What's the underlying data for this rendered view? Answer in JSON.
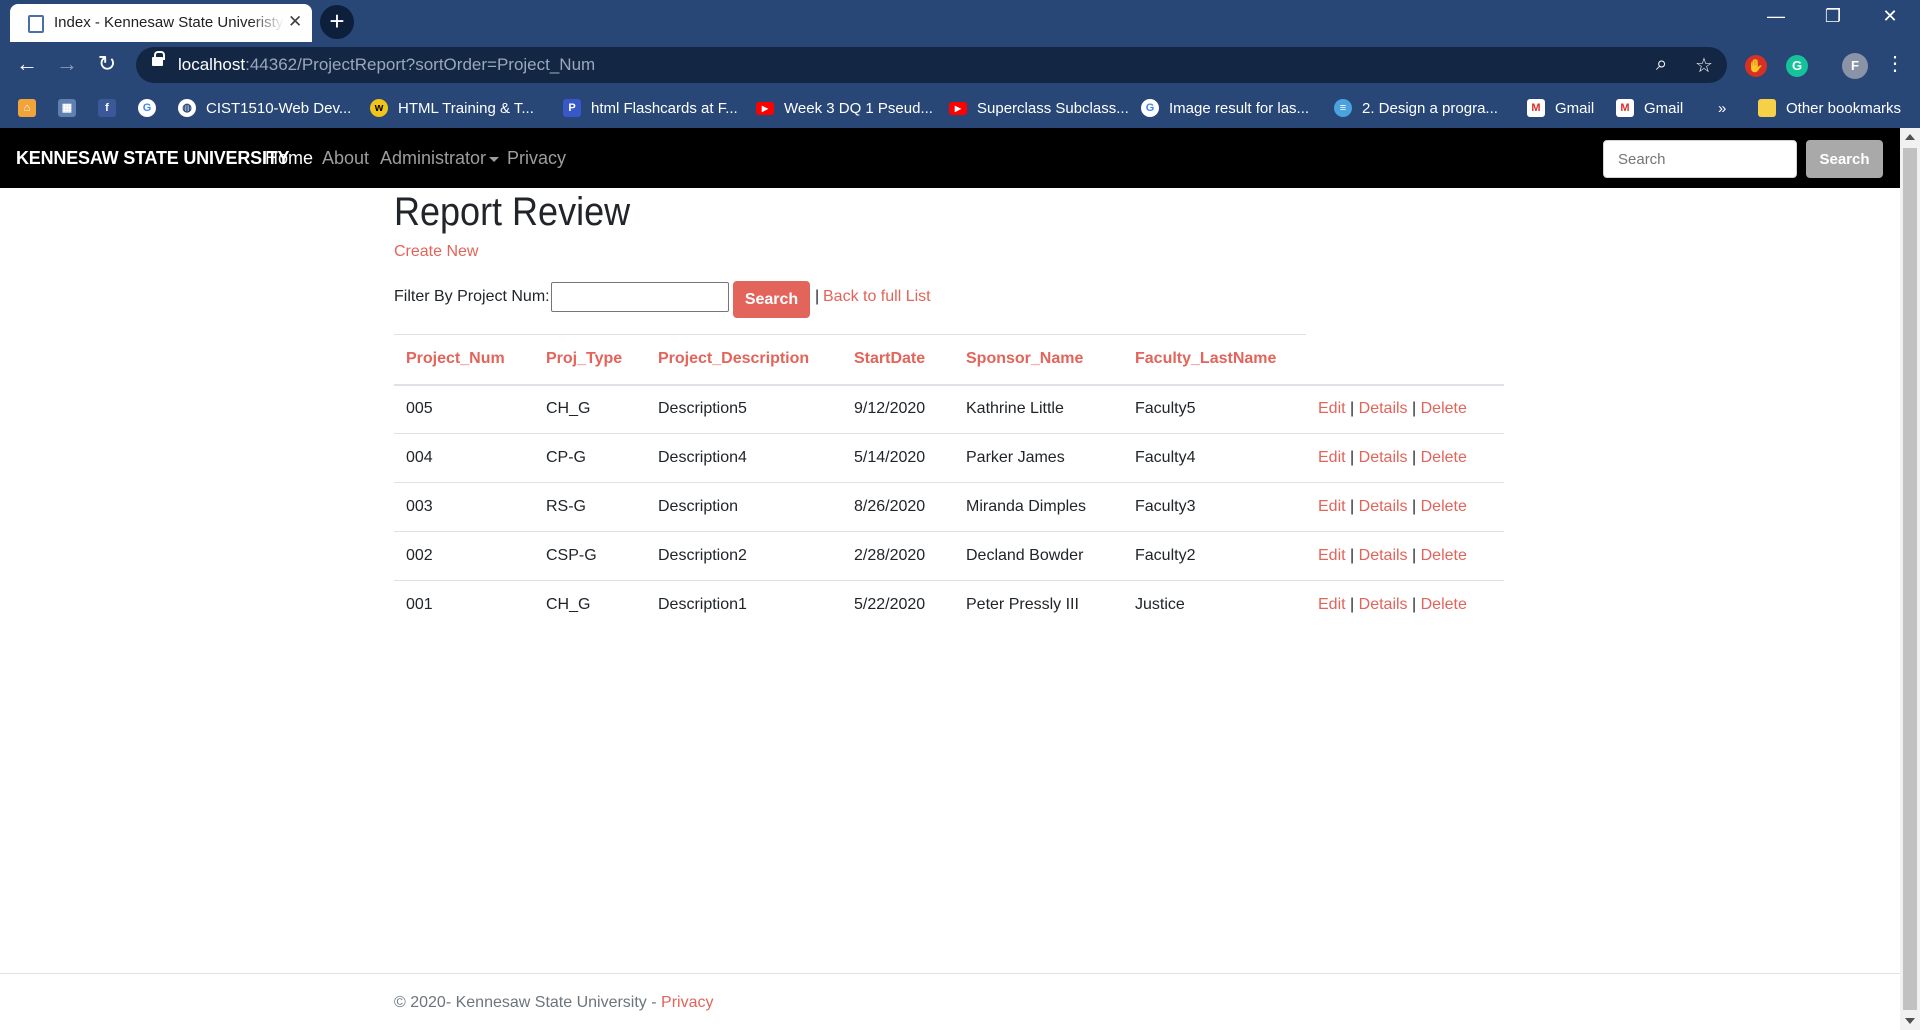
{
  "browser": {
    "tab_title": "Index - Kennesaw State Univeristy",
    "new_tab": "+",
    "url_host": "localhost",
    "url_rest": ":44362/ProjectReport?sortOrder=Project_Num",
    "profile_initial": "F",
    "bookmarks": [
      {
        "label": "",
        "icon": "home-icon",
        "color": "#f2a33a"
      },
      {
        "label": "",
        "icon": "calendar-icon",
        "color": "#5f7fb0"
      },
      {
        "label": "",
        "icon": "facebook-icon",
        "color": "#3b5998"
      },
      {
        "label": "",
        "icon": "google-icon",
        "color": "#ffffff"
      },
      {
        "label": "CIST1510-Web Dev...",
        "icon": "globe-icon",
        "color": "#ffffff"
      },
      {
        "label": "HTML Training & T...",
        "icon": "w3-icon",
        "color": "#f0c419"
      },
      {
        "label": "html Flashcards at F...",
        "icon": "p-icon",
        "color": "#3858c7"
      },
      {
        "label": "Week 3 DQ 1 Pseud...",
        "icon": "youtube-icon",
        "color": "#ff0000"
      },
      {
        "label": "Superclass Subclass...",
        "icon": "youtube-icon",
        "color": "#ff0000"
      },
      {
        "label": "Image result for las...",
        "icon": "google-icon",
        "color": "#ffffff"
      },
      {
        "label": "2. Design a progra...",
        "icon": "att-icon",
        "color": "#4aa3df"
      },
      {
        "label": "Gmail",
        "icon": "gmail-icon",
        "color": "#ffffff"
      },
      {
        "label": "Gmail",
        "icon": "gmail-icon",
        "color": "#ffffff"
      }
    ],
    "bookmarks_more": "»",
    "other_bookmarks": "Other bookmarks"
  },
  "site": {
    "brand": "KENNESAW STATE UNIVERSITY",
    "nav": {
      "home": "Home",
      "about": "About",
      "administrator": "Administrator",
      "privacy": "Privacy"
    },
    "search_placeholder": "Search",
    "search_button": "Search"
  },
  "page": {
    "title": "Report Review",
    "create_new": "Create New",
    "filter_label": "Filter By Project Num:",
    "filter_value": "",
    "filter_button": "Search",
    "separator": "|",
    "back_link": "Back to full List"
  },
  "table": {
    "headers": [
      "Project_Num",
      "Proj_Type",
      "Project_Description",
      "StartDate",
      "Sponsor_Name",
      "Faculty_LastName"
    ],
    "action_labels": {
      "edit": "Edit",
      "details": "Details",
      "delete": "Delete",
      "pipe": "|"
    },
    "rows": [
      [
        "005",
        "CH_G",
        "Description5",
        "9/12/2020",
        "Kathrine Little",
        "Faculty5"
      ],
      [
        "004",
        "CP-G",
        "Description4",
        "5/14/2020",
        "Parker James",
        "Faculty4"
      ],
      [
        "003",
        "RS-G",
        "Description",
        "8/26/2020",
        "Miranda Dimples",
        "Faculty3"
      ],
      [
        "002",
        "CSP-G",
        "Description2",
        "2/28/2020",
        "Decland Bowder",
        "Faculty2"
      ],
      [
        "001",
        "CH_G",
        "Description1",
        "5/22/2020",
        "Peter Pressly III",
        "Justice"
      ]
    ]
  },
  "footer": {
    "text": "© 2020- Kennesaw State University - ",
    "privacy": "Privacy"
  }
}
